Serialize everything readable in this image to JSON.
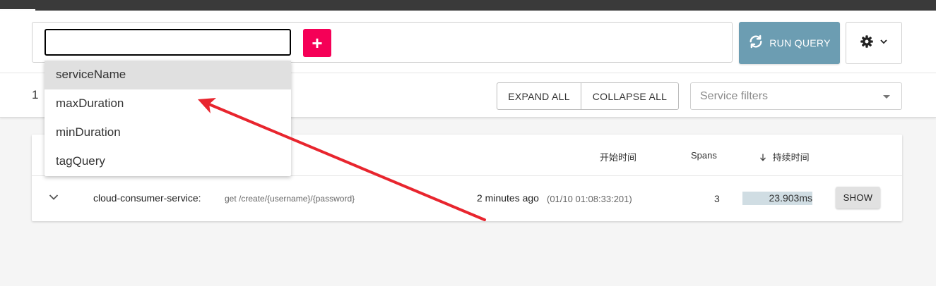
{
  "query": {
    "input_value": "",
    "add_label": "+",
    "run_label": "RUN QUERY"
  },
  "suggestions": [
    "serviceName",
    "maxDuration",
    "minDuration",
    "tagQuery"
  ],
  "results_bar": {
    "count": "1",
    "expand_label": "EXPAND ALL",
    "collapse_label": "COLLAPSE ALL",
    "service_filter_placeholder": "Service filters"
  },
  "table": {
    "columns": {
      "start_time": "开始时间",
      "spans": "Spans",
      "duration": "持续时间"
    },
    "rows": [
      {
        "service": "cloud-consumer-service:",
        "operation": "get /create/{username}/{password}",
        "relative_time": "2 minutes ago",
        "timestamp": "(01/10 01:08:33:201)",
        "spans": "3",
        "duration": "23.903ms",
        "show_label": "SHOW"
      }
    ]
  },
  "colors": {
    "topbar": "#3a3a3a",
    "accent_pink": "#f50057",
    "run_query_bg": "#6c9db2",
    "duration_bar": "#d0dde3",
    "annotation_arrow": "#e8252e"
  }
}
